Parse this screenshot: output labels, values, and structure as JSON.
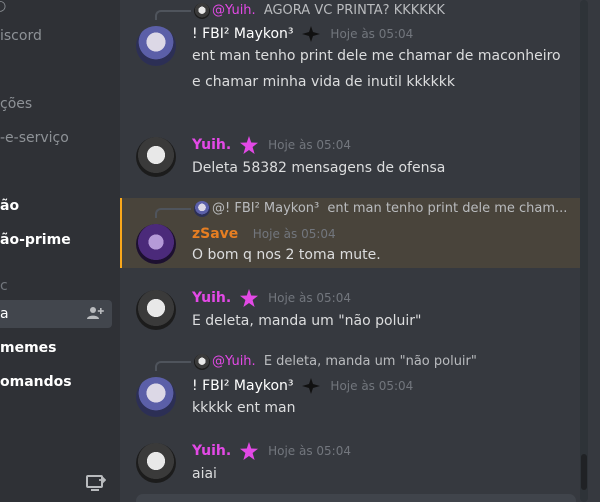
{
  "sidebar": {
    "items": [
      {
        "label": "iscord"
      },
      {
        "label": "ções"
      },
      {
        "label": "-e-serviço"
      },
      {
        "label": "ão"
      },
      {
        "label": "ão-prime"
      },
      {
        "label": "a"
      },
      {
        "label": "memes"
      },
      {
        "label": "omandos"
      }
    ]
  },
  "messages": [
    {
      "reply": {
        "author": "@Yuih.",
        "text": "AGORA VC PRINTA? KKKKKK"
      },
      "author": "! FBI² Maykon³",
      "time": "Hoje às 05:04",
      "lines": [
        "ent man tenho print dele me chamar de maconheiro",
        "e chamar minha vida de inutil kkkkkk"
      ]
    },
    {
      "author": "Yuih.",
      "time": "Hoje às 05:04",
      "lines": [
        "Deleta 58382 mensagens de ofensa"
      ]
    },
    {
      "reply": {
        "author": "@! FBI² Maykon³",
        "text": "ent man tenho print dele me cham..."
      },
      "author": "zSave",
      "time": "Hoje às 05:04",
      "lines": [
        "O bom q nos 2 toma mute."
      ]
    },
    {
      "author": "Yuih.",
      "time": "Hoje às 05:04",
      "lines": [
        "E deleta, manda um \"não poluir\""
      ]
    },
    {
      "reply": {
        "author": "@Yuih.",
        "text": "E deleta, manda um \"não poluir\""
      },
      "author": "! FBI² Maykon³",
      "time": "Hoje às 05:04",
      "lines": [
        "kkkkk ent man"
      ]
    },
    {
      "author": "Yuih.",
      "time": "Hoje às 05:04",
      "lines": [
        "aiai"
      ]
    }
  ],
  "colors": {
    "yuih": "#e349e6",
    "zsave": "#e67e22",
    "maykon": "#ffffff",
    "highlight": "#faa81a"
  }
}
